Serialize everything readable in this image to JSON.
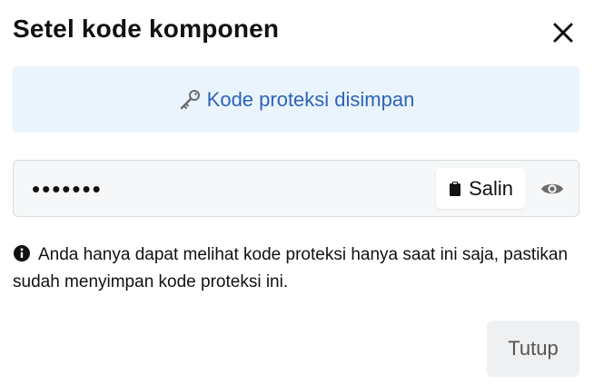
{
  "dialog": {
    "title": "Setel kode komponen",
    "close_icon": "close-icon"
  },
  "banner": {
    "icon": "key-icon",
    "text": "Kode proteksi disimpan",
    "background": "#eaf4fd",
    "text_color": "#2e63b8"
  },
  "code_field": {
    "value": "•••••••",
    "copy_icon": "clipboard-icon",
    "copy_label": "Salin",
    "reveal_icon": "eye-icon"
  },
  "note": {
    "icon": "info-icon",
    "text": "Anda hanya dapat melihat kode proteksi hanya saat ini saja, pastikan sudah menyimpan kode proteksi ini."
  },
  "footer": {
    "close_label": "Tutup"
  }
}
